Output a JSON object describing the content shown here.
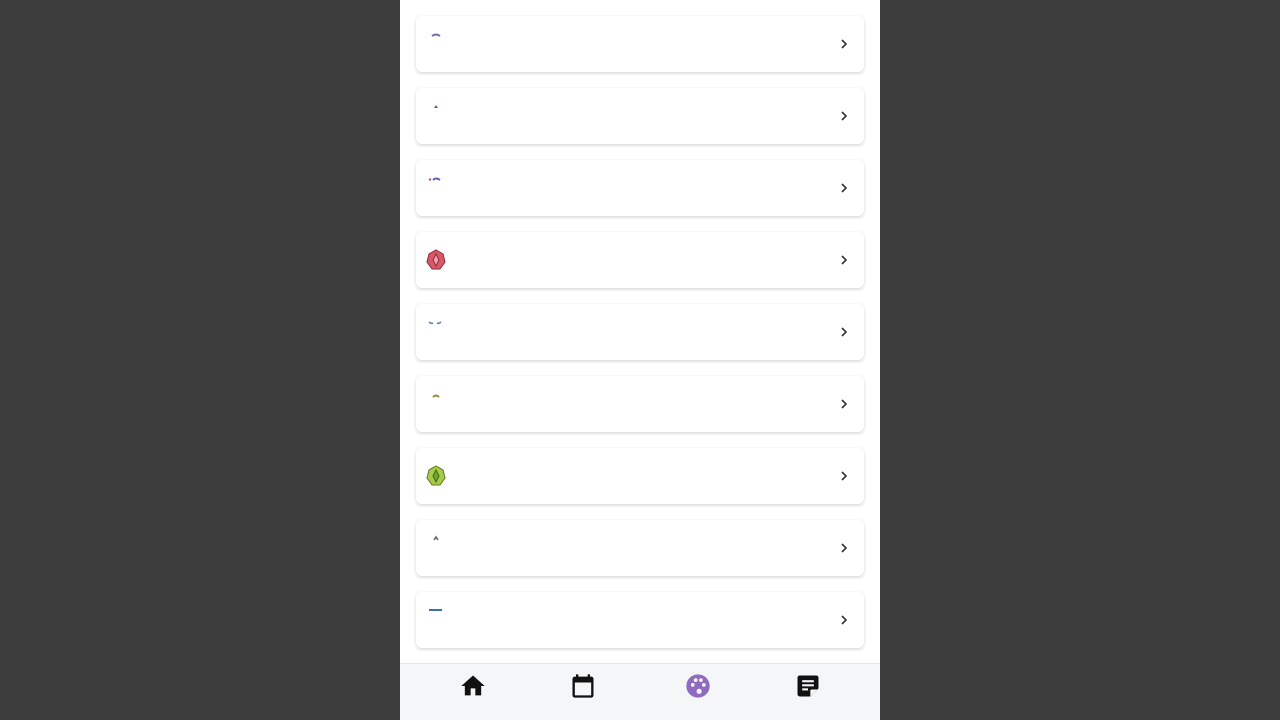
{
  "colors": {
    "backdrop": "#3d3d3d",
    "surface": "#ffffff",
    "navbar": "#f5f6f8",
    "active_nav": "#8e6bbf",
    "chevron": "#333333"
  },
  "list": {
    "items": [
      {
        "icon": "sliver-arc-blue-icon"
      },
      {
        "icon": "small-blue-peak-icon"
      },
      {
        "icon": "small-red-blue-sliver-icon"
      },
      {
        "icon": "red-gem-badge-icon"
      },
      {
        "icon": "blue-wings-sliver-icon"
      },
      {
        "icon": "olive-arc-sliver-icon"
      },
      {
        "icon": "green-gem-badge-icon"
      },
      {
        "icon": "small-gray-peak-icon"
      },
      {
        "icon": "blue-dash-icon"
      }
    ]
  },
  "nav": {
    "items": [
      {
        "icon": "home-icon",
        "active": false
      },
      {
        "icon": "calendar-icon",
        "active": false
      },
      {
        "icon": "palette-icon",
        "active": true
      },
      {
        "icon": "note-icon",
        "active": false
      }
    ]
  }
}
